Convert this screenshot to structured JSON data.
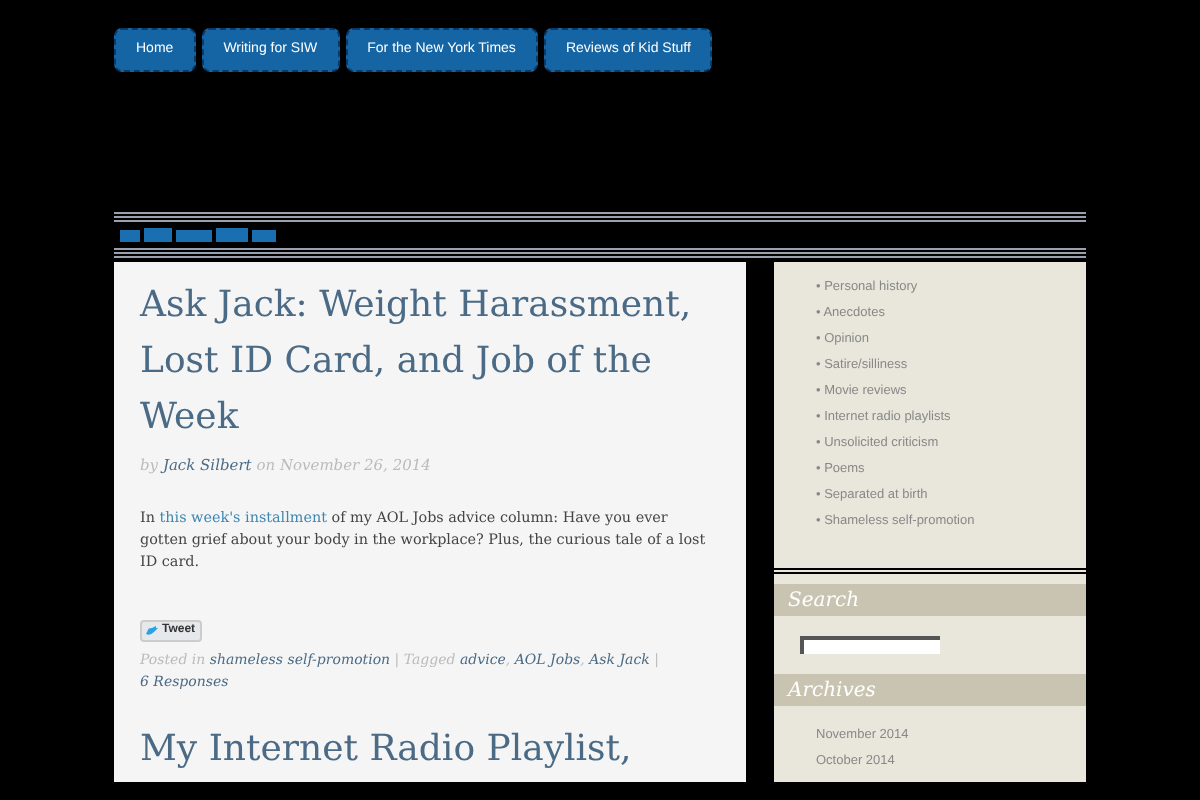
{
  "nav": [
    {
      "label": "Home"
    },
    {
      "label": "Writing for SIW"
    },
    {
      "label": "For the New York Times"
    },
    {
      "label": "Reviews of Kid Stuff"
    }
  ],
  "posts": [
    {
      "title": "Ask Jack: Weight Harassment, Lost ID Card, and Job of the Week",
      "by": "by",
      "author": "Jack Silbert",
      "on": "on",
      "date": "November 26, 2014",
      "excerpt": [
        {
          "kind": "text",
          "text": "In "
        },
        {
          "kind": "link",
          "text": "this week's installment"
        },
        {
          "kind": "text",
          "text": " of my AOL Jobs advice column: Have you ever gotten grief about your body in the workplace? Plus, the curious tale of a lost ID card."
        }
      ],
      "tweet": "Tweet",
      "footer": [
        {
          "kind": "text",
          "text": "Posted in "
        },
        {
          "kind": "link",
          "text": "shameless self-promotion"
        },
        {
          "kind": "text",
          "text": " | Tagged "
        },
        {
          "kind": "link",
          "text": "advice"
        },
        {
          "kind": "text",
          "text": ", "
        },
        {
          "kind": "link",
          "text": "AOL Jobs"
        },
        {
          "kind": "text",
          "text": ", "
        },
        {
          "kind": "link",
          "text": "Ask Jack"
        },
        {
          "kind": "text",
          "text": " | "
        },
        {
          "kind": "link",
          "text": "6 Responses"
        }
      ]
    },
    {
      "title": "My Internet Radio Playlist,"
    }
  ],
  "sidebar": {
    "categories": [
      "• Personal history",
      "• Anecdotes",
      "• Opinion",
      "• Satire/silliness",
      "• Movie reviews",
      "• Internet radio playlists",
      "• Unsolicited criticism",
      "• Poems",
      "• Separated at birth",
      "• Shameless self-promotion"
    ],
    "search_heading": "Search",
    "archives_heading": "Archives",
    "archives": [
      "November 2014",
      "October 2014"
    ]
  }
}
